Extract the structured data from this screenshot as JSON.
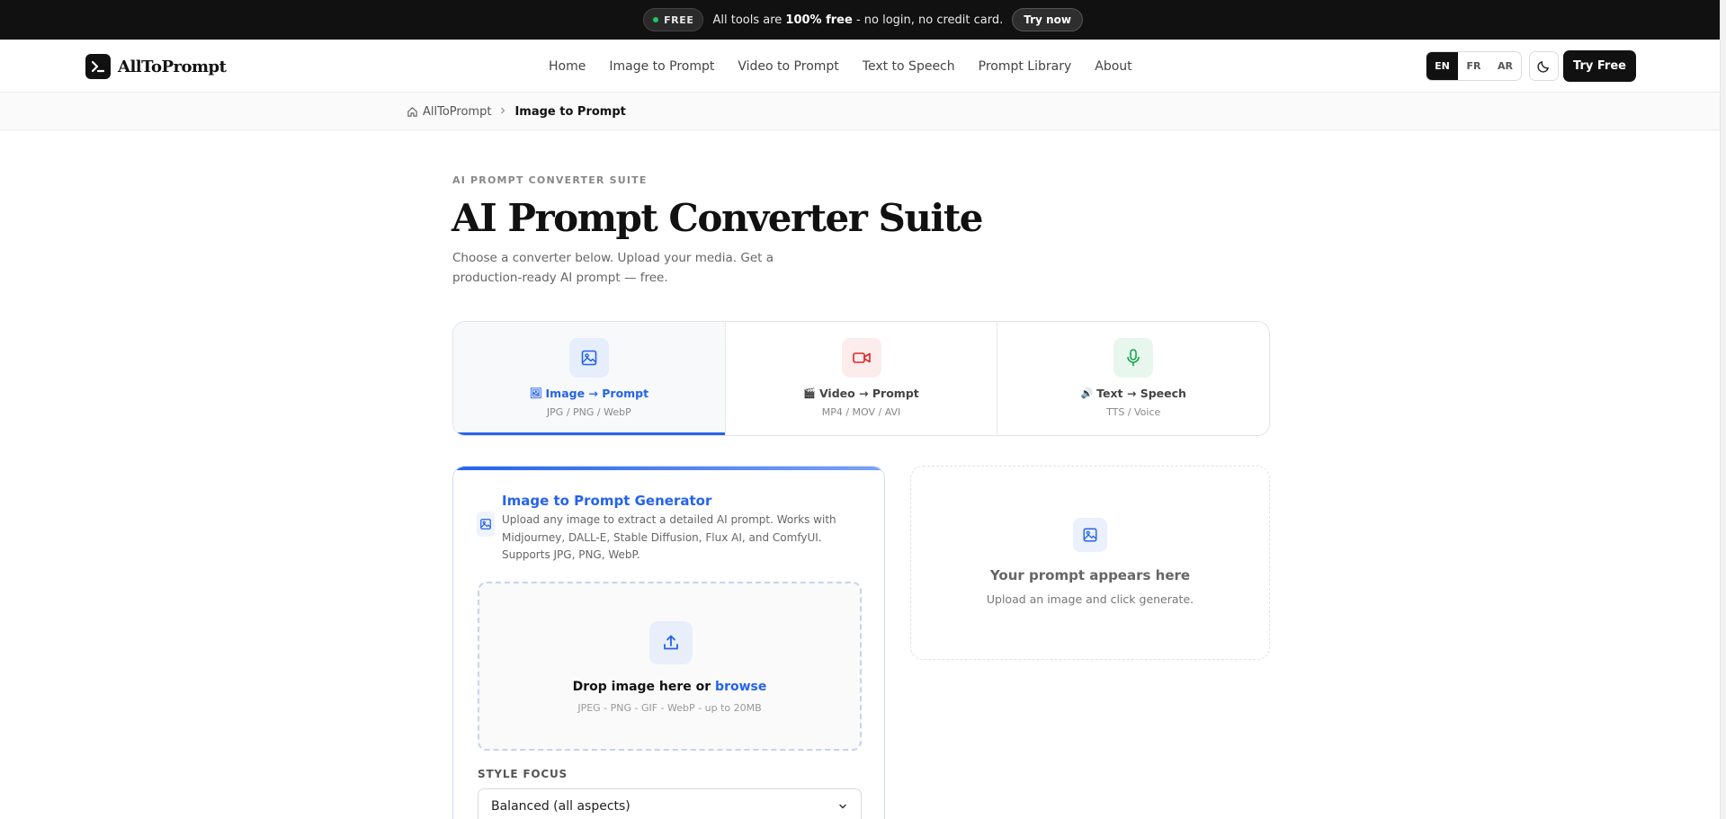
{
  "announcement": {
    "badge": "FREE",
    "text_prefix": "All tools are ",
    "text_bold": "100% free",
    "text_suffix": " - no login, no credit card.",
    "cta": "Try now"
  },
  "header": {
    "brand": "AllToPrompt",
    "nav": [
      "Home",
      "Image to Prompt",
      "Video to Prompt",
      "Text to Speech",
      "Prompt Library",
      "About"
    ],
    "languages": [
      "EN",
      "FR",
      "AR"
    ],
    "active_language": "EN",
    "theme_icon": "moon-icon",
    "cta": "Try Free"
  },
  "breadcrumb": {
    "home": "AllToPrompt",
    "current": "Image to Prompt"
  },
  "hero": {
    "eyebrow": "AI PROMPT CONVERTER SUITE",
    "title": "AI Prompt Converter Suite",
    "subtitle": "Choose a converter below. Upload your media. Get a production-ready AI prompt — free."
  },
  "tabs": [
    {
      "emoji": "🖼",
      "label": "Image → Prompt",
      "sub": "JPG / PNG / WebP",
      "icon": "image-icon",
      "color": "#2563eb",
      "bg": "#e6edfb",
      "active": true
    },
    {
      "emoji": "🎬",
      "label": "Video → Prompt",
      "sub": "MP4 / MOV / AVI",
      "icon": "video-icon",
      "color": "#dc2626",
      "bg": "#fdecec",
      "active": false
    },
    {
      "emoji": "🔊",
      "label": "Text → Speech",
      "sub": "TTS / Voice",
      "icon": "mic-icon",
      "color": "#16a34a",
      "bg": "#e8f7ee",
      "active": false
    }
  ],
  "generator": {
    "title": "Image to Prompt Generator",
    "description": "Upload any image to extract a detailed AI prompt. Works with Midjourney, DALL-E, Stable Diffusion, Flux AI, and ComfyUI. Supports JPG, PNG, WebP.",
    "drop_text": "Drop image here or ",
    "drop_link": "browse",
    "drop_formats": "JPEG - PNG - GIF - WebP - up to 20MB",
    "style_label": "STYLE FOCUS",
    "style_value": "Balanced (all aspects)"
  },
  "output": {
    "title": "Your prompt appears here",
    "subtitle": "Upload an image and click generate."
  },
  "colors": {
    "accent": "#2563eb",
    "dark": "#111111"
  }
}
